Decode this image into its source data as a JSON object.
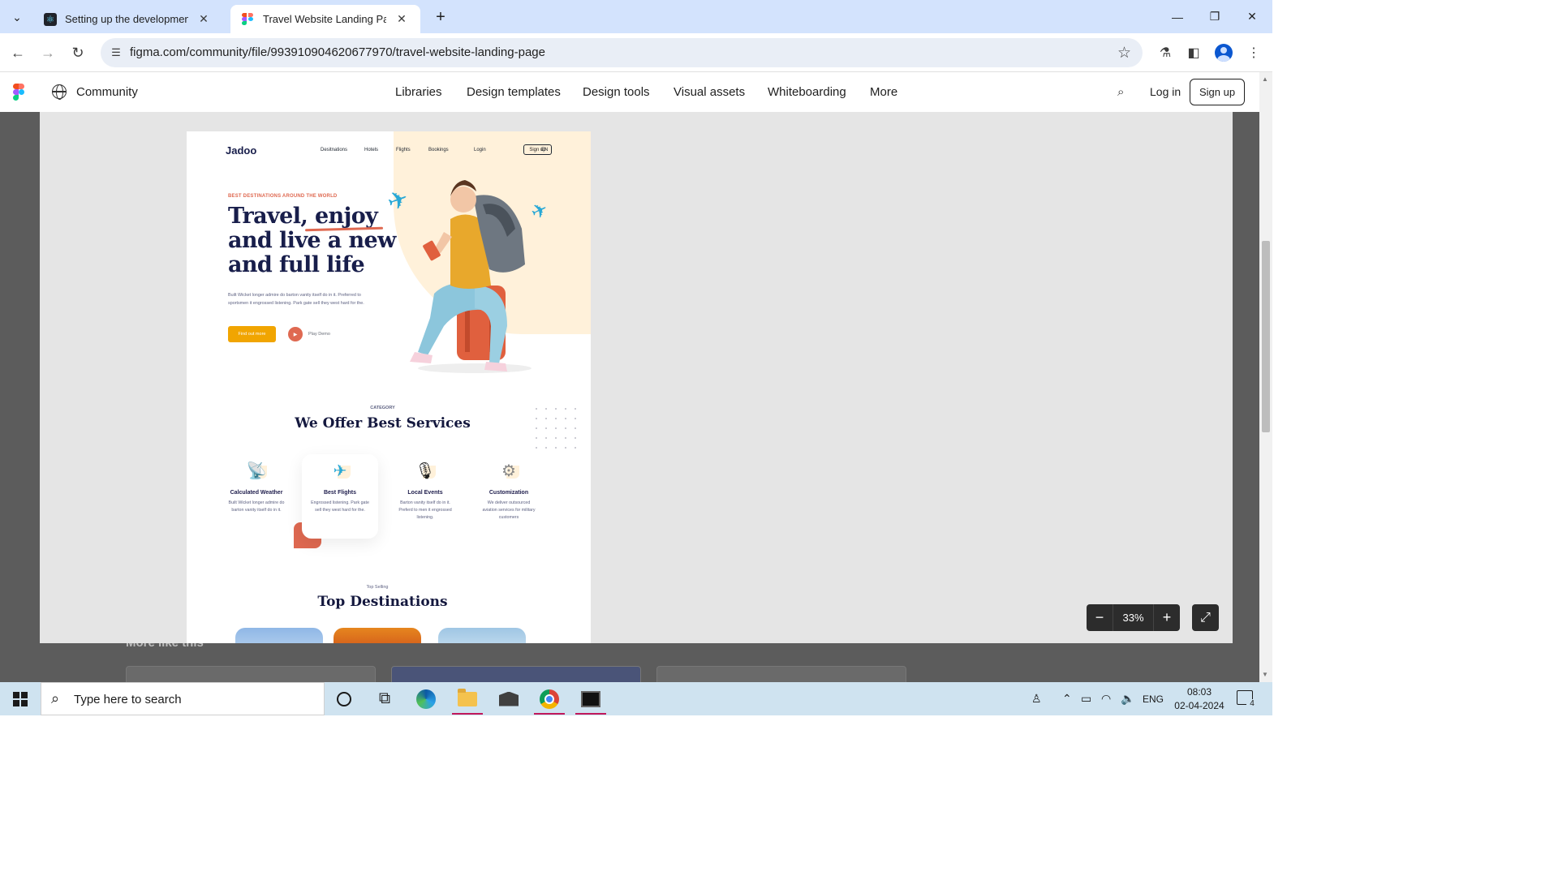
{
  "browser": {
    "tabs": [
      {
        "title": "Setting up the development en"
      },
      {
        "title": "Travel Website Landing Page | F"
      }
    ],
    "url": "figma.com/community/file/993910904620677970/travel-website-landing-page"
  },
  "figma_header": {
    "community_label": "Community",
    "nav": [
      "Libraries",
      "Design templates",
      "Design tools",
      "Visual assets",
      "Whiteboarding",
      "More"
    ],
    "login": "Log in",
    "signup": "Sign up"
  },
  "background": {
    "more_like_this": "More like this"
  },
  "viewer": {
    "zoom": "33%"
  },
  "preview": {
    "logo": "Jadoo",
    "nav": [
      "Desitnations",
      "Hotels",
      "Flights",
      "Bookings",
      "Login"
    ],
    "signup": "Sign up",
    "lang": "EN",
    "eyebrow": "BEST DESTINATIONS AROUND THE WORLD",
    "headline": "Travel, enjoy and live a new and full life",
    "hero_text": "Built Wicket longer admire do barton vanity itself do in it. Preferred to sportsmen it engrossed listening. Park gate sell they west hard for the.",
    "cta": "Find out more",
    "play": "Play Demo",
    "category_label": "CATEGORY",
    "services_title": "We Offer Best Services",
    "services": [
      {
        "name": "Calculated Weather",
        "desc": "Built Wicket longer admire do barton vanity itself do in it."
      },
      {
        "name": "Best Flights",
        "desc": "Engrossed listening. Park gate sell they west hard for the."
      },
      {
        "name": "Local Events",
        "desc": "Barton vanity itself do in it. Preferd to men it engrossed listening."
      },
      {
        "name": "Customization",
        "desc": "We deliver outsourced aviation services for military customers"
      }
    ],
    "top_selling_label": "Top Selling",
    "destinations_title": "Top Destinations"
  },
  "taskbar": {
    "search_placeholder": "Type here to search",
    "lang": "ENG",
    "time": "08:03",
    "date": "02-04-2024",
    "notifications": "4"
  }
}
